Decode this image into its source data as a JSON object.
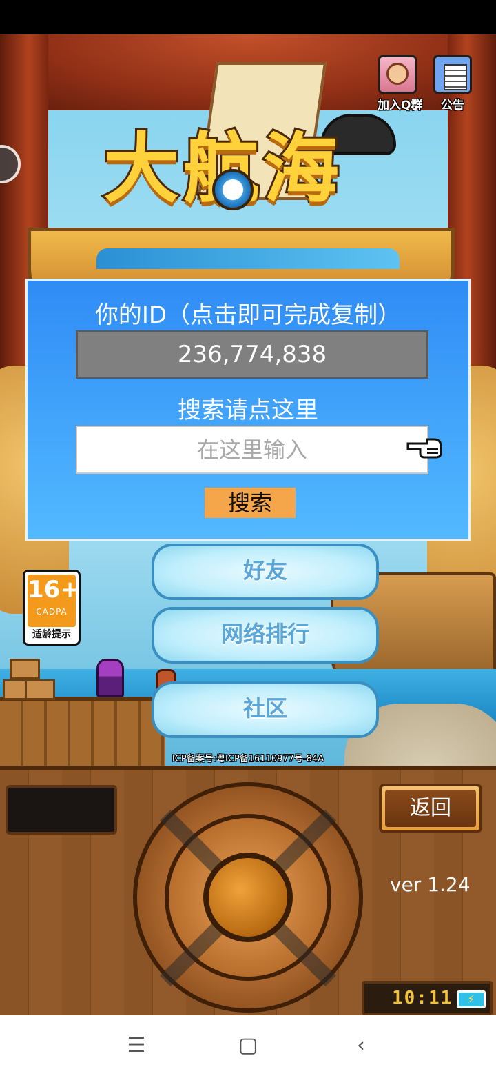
{
  "top_buttons": {
    "join_qq_label": "加入Q群",
    "notice_label": "公告"
  },
  "logo": {
    "title": "大航海"
  },
  "dialog": {
    "title": "你的ID（点击即可完成复制）",
    "user_id": "236,774,838",
    "search_hint": "搜索请点这里",
    "search_placeholder": "在这里输入",
    "search_button": "搜索"
  },
  "menu": {
    "friends": "好友",
    "ranking": "网络排行",
    "community": "社区"
  },
  "age_rating": {
    "age": "16+",
    "org": "CADPA",
    "tip": "适龄提示"
  },
  "icp": "ICP备案号:粤ICP备16110977号-84A",
  "console": {
    "back_label": "返回",
    "version": "ver 1.24",
    "clock": "10:11",
    "battery_glyph": "⚡"
  },
  "navbar": {
    "menu_glyph": "☰",
    "home_glyph": "▢",
    "back_glyph": "‹"
  },
  "colors": {
    "dialog_blue": "#2f8cf5",
    "search_button": "#f5a54a",
    "id_box": "#808080",
    "age_orange": "#f39a1d"
  }
}
